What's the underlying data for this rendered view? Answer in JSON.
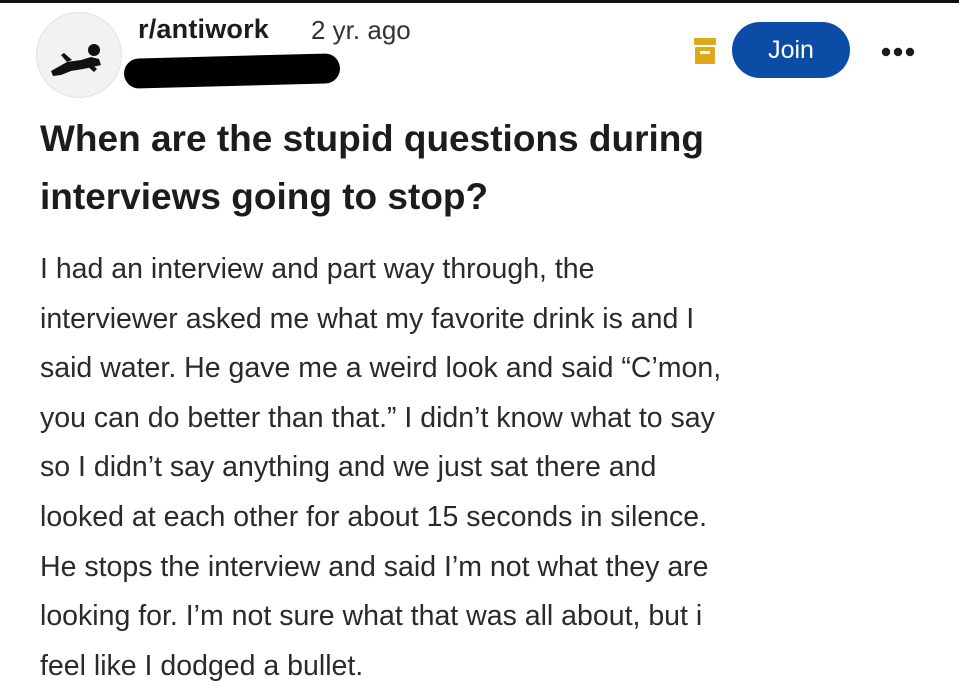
{
  "post": {
    "subreddit": "r/antiwork",
    "age": "2 yr. ago",
    "join_label": "Join",
    "title_lines": [
      "When are the stupid questions during",
      "interviews going to stop?"
    ],
    "body_lines": [
      "I had an interview and part way through, the",
      "interviewer asked me what my favorite drink is and I",
      "said water. He gave me a weird look and said “C’mon,",
      "you can do better than that.” I didn’t know what to say",
      "so I didn’t say anything and we just sat there and",
      "looked at each other for about 15 seconds in silence.",
      "He stops the interview and said I’m not what they are",
      "looking for. I’m not sure what that was all about, but i",
      "feel like I dodged a bullet."
    ]
  },
  "icons": {
    "avatar": "subreddit-avatar-reclining-figure",
    "archive": "archive-box-icon",
    "more": "more-options-icon"
  },
  "colors": {
    "join_button": "#0b4da6",
    "archive_icon": "#e0a81b",
    "text": "#1c1c1c",
    "redaction": "#000000"
  }
}
